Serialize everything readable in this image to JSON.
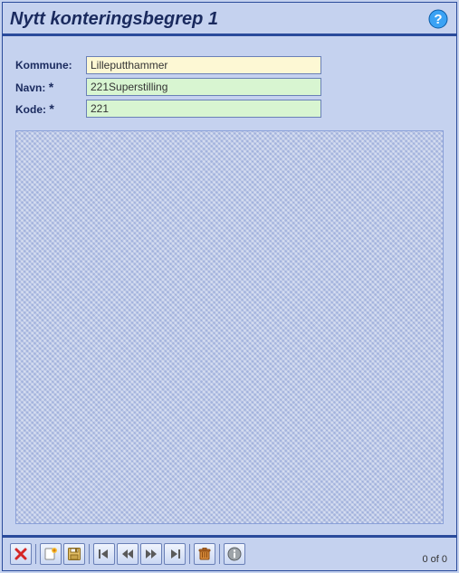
{
  "title": "Nytt konteringsbegrep 1",
  "help": {
    "iconName": "help-icon"
  },
  "form": {
    "fields": [
      {
        "label": "Kommune:",
        "required": false,
        "value": "Lilleputthammer",
        "editable": false,
        "name": "kommune-field"
      },
      {
        "label": "Navn:",
        "required": true,
        "value": "221Superstilling",
        "editable": true,
        "name": "navn-field"
      },
      {
        "label": "Kode:",
        "required": true,
        "value": "221",
        "editable": true,
        "name": "kode-field"
      }
    ]
  },
  "toolbar": {
    "buttons": {
      "cancel": {
        "label": "Avbryt",
        "icon": "x-red"
      },
      "new": {
        "label": "Ny",
        "icon": "new"
      },
      "save": {
        "label": "Lagre",
        "icon": "floppy"
      },
      "first": {
        "label": "Første",
        "icon": "nav-first"
      },
      "prev": {
        "label": "Forrige",
        "icon": "nav-prev"
      },
      "next": {
        "label": "Neste",
        "icon": "nav-next"
      },
      "last": {
        "label": "Siste",
        "icon": "nav-last"
      },
      "delete": {
        "label": "Slett",
        "icon": "trash"
      },
      "info": {
        "label": "Info",
        "icon": "info"
      }
    }
  },
  "counter": "0 of 0"
}
